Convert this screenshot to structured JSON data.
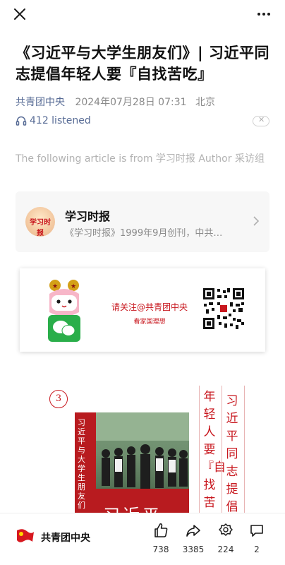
{
  "article": {
    "title": "《习近平与大学生朋友们》| 习近平同志提倡年轻人要『自找苦吃』",
    "account": "共青团中央",
    "date": "2024年07月28日 07:31",
    "location": "北京",
    "listened": "412 listened",
    "source_note": "The following article is from 学习时报 Author 采访组"
  },
  "source_card": {
    "name": "学习时报",
    "desc": "《学习时报》1999年9月创刊，中共…",
    "avatar_text": "学习时报"
  },
  "banner": {
    "cta": "请关注@共青团中央",
    "sub": "看家国理想"
  },
  "poster": {
    "number": "3",
    "book_title": "习近平与大学生朋友们",
    "book_big_text": "习近平",
    "col1": "年轻人要『自找苦吃",
    "col2": "习近平同志提倡"
  },
  "bottom_bar": {
    "account": "共青团中央",
    "likes": "738",
    "shares": "3385",
    "wows": "224",
    "comments": "2"
  },
  "icons": {
    "close": "close-icon",
    "more": "more-icon",
    "headphones": "headphones-icon",
    "chevron": "chevron-right-icon",
    "like": "thumbs-up-icon",
    "share": "share-icon",
    "wow": "wow-icon",
    "comment": "comment-icon"
  },
  "colors": {
    "link": "#576b95",
    "brand_red": "#c8171e",
    "muted": "#8a8a8a"
  }
}
